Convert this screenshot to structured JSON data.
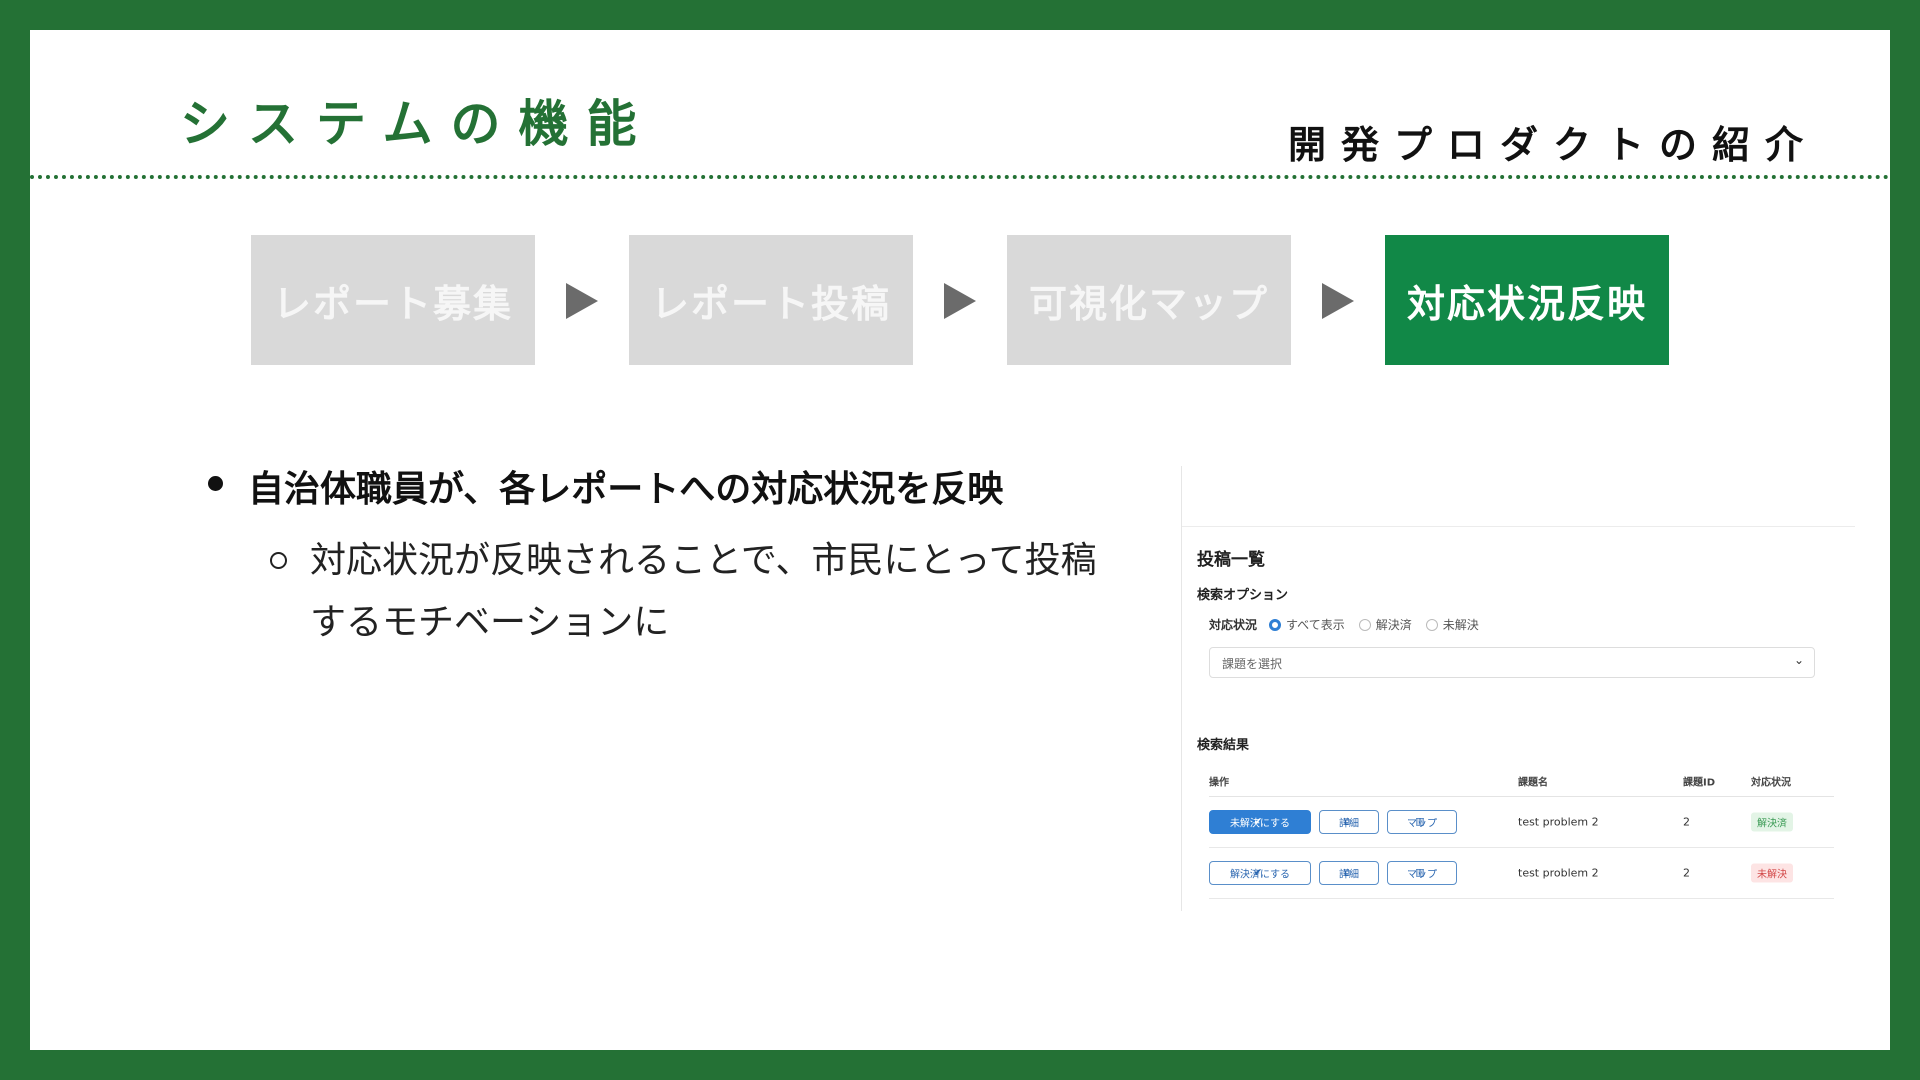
{
  "slide": {
    "title": "システムの機能",
    "subtitle": "開発プロダクトの紹介"
  },
  "flow": {
    "steps": [
      "レポート募集",
      "レポート投稿",
      "可視化マップ",
      "対応状況反映"
    ],
    "active_step": "対応状況反映"
  },
  "bullets": {
    "main": "自治体職員が、各レポートへの対応状況を反映",
    "sub": "対応状況が反映されることで、市民にとって投稿するモチベーションに"
  },
  "screenshot": {
    "page_title": "投稿一覧",
    "search_options_label": "検索オプション",
    "filter_label": "対応状況",
    "filter_options": [
      "すべて表示",
      "解決済",
      "未解決"
    ],
    "filter_selected": "すべて表示",
    "select_placeholder": "課題を選択",
    "results_label": "検索結果",
    "columns": [
      "操作",
      "課題名",
      "課題ID",
      "対応状況"
    ],
    "rows": [
      {
        "action_label": "未解決にする",
        "detail_label": "詳細",
        "map_label": "マップ",
        "name": "test problem 2",
        "id": "2",
        "status": "解決済"
      },
      {
        "action_label": "解決済にする",
        "detail_label": "詳細",
        "map_label": "マップ",
        "name": "test problem 2",
        "id": "2",
        "status": "未解決"
      }
    ]
  },
  "colors": {
    "brand_green": "#247135",
    "active_step": "#118847",
    "inactive_step": "#d9d9d9",
    "primary_button": "#2f7fd4"
  }
}
